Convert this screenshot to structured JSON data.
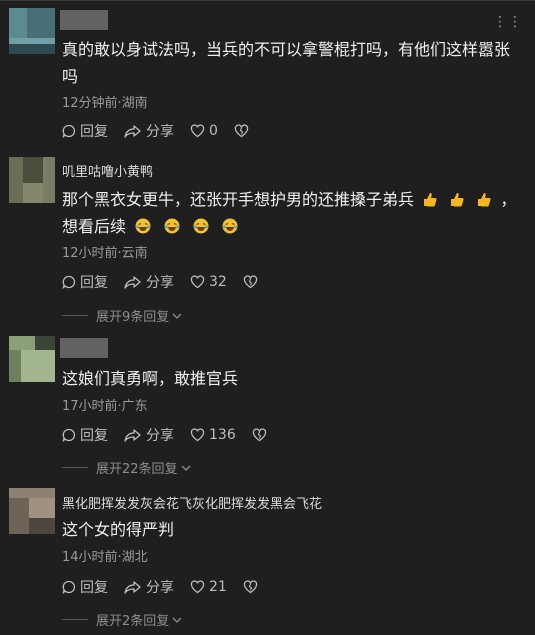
{
  "ui": {
    "more_glyph": "⋮⋮",
    "reply_label": "回复",
    "share_label": "分享"
  },
  "comments": [
    {
      "username": "",
      "text": "真的敢以身试法吗，当兵的不可以拿警棍打吗，有他们这样嚣张吗",
      "time_location": "12分钟前·湖南",
      "likes": "0",
      "expand": ""
    },
    {
      "username": "叽里咕噜小黄鸭",
      "text_main": "那个黑衣女更牛，还张开手想护男的还推搡子弟兵",
      "text_end": "，",
      "text_line2": "想看后续",
      "time_location": "12小时前·云南",
      "likes": "32",
      "expand": "展开9条回复"
    },
    {
      "username": "",
      "text": "这娘们真勇啊，敢推官兵",
      "time_location": "17小时前·广东",
      "likes": "136",
      "expand": "展开22条回复"
    },
    {
      "username": "黑化肥挥发发灰会花飞灰化肥挥发发黑会飞花",
      "text": "这个女的得严判",
      "time_location": "14小时前·湖北",
      "likes": "21",
      "expand": "展开2条回复"
    }
  ],
  "colors": {
    "background": "#1f1f1f",
    "text": "#f0f0f0",
    "meta": "#9b9b9b",
    "thumbs_emoji": "#f5b624",
    "laugh_emoji": "#f2c230"
  }
}
